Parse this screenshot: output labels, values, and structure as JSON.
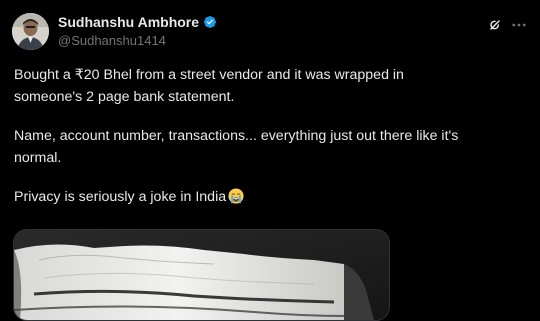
{
  "author": {
    "display_name": "Sudhanshu Ambhore",
    "handle": "@Sudhanshu1414",
    "verified": true
  },
  "tweet": {
    "lines": [
      "Bought a ₹20 Bhel from a street vendor and it was wrapped in",
      "someone's 2 page bank statement.",
      "Name, account number, transactions... everything just out there like it's",
      "normal.",
      "Privacy is seriously a joke in India"
    ],
    "trailing_emoji": "loudly-crying-face-emoji"
  },
  "icons": {
    "verified": "verified-badge-icon",
    "grok": "grok-icon",
    "more": "more-options-icon"
  },
  "colors": {
    "background": "#000000",
    "text_primary": "#e7e9ea",
    "text_secondary": "#71767b",
    "verified_blue": "#1d9bf0",
    "media_border": "#2f3336"
  },
  "media": {
    "description_icon": "photo"
  }
}
